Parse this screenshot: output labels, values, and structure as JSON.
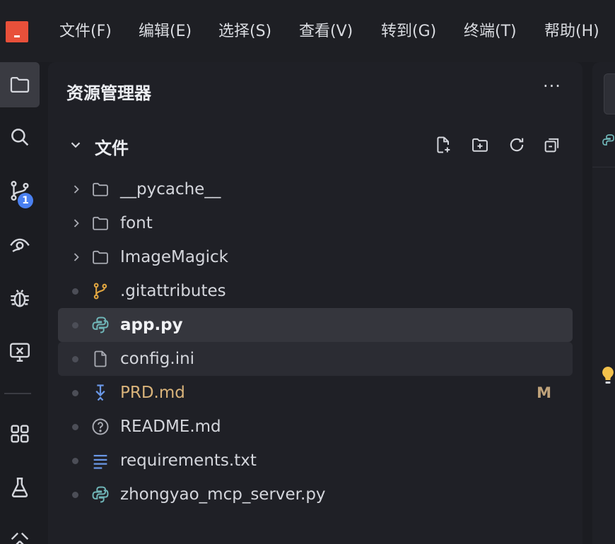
{
  "menu": {
    "items": [
      {
        "label": "文件(F)"
      },
      {
        "label": "编辑(E)"
      },
      {
        "label": "选择(S)"
      },
      {
        "label": "查看(V)"
      },
      {
        "label": "转到(G)"
      },
      {
        "label": "终端(T)"
      },
      {
        "label": "帮助(H)"
      }
    ]
  },
  "activity_bar": {
    "items": [
      {
        "icon": "files-icon",
        "active": true
      },
      {
        "icon": "search-icon"
      },
      {
        "icon": "source-control-icon",
        "badge": "1"
      },
      {
        "icon": "eye-icon"
      },
      {
        "icon": "debug-icon"
      },
      {
        "icon": "remote-icon"
      },
      {
        "icon": "extensions-icon"
      },
      {
        "icon": "testing-icon"
      },
      {
        "icon": "tools-icon"
      }
    ]
  },
  "explorer": {
    "title": "资源管理器",
    "more_label": "···",
    "section_title": "文件",
    "toolbar": [
      "new-file-icon",
      "new-folder-icon",
      "refresh-icon",
      "collapse-all-icon"
    ],
    "items": [
      {
        "label": "__pycache__",
        "type": "folder",
        "icon": "folder-icon"
      },
      {
        "label": "font",
        "type": "folder",
        "icon": "folder-icon"
      },
      {
        "label": "ImageMagick",
        "type": "folder",
        "icon": "folder-icon"
      },
      {
        "label": ".gitattributes",
        "type": "file",
        "icon": "git-branch-icon"
      },
      {
        "label": "app.py",
        "type": "file",
        "icon": "python-icon",
        "state": "selected"
      },
      {
        "label": "config.ini",
        "type": "file",
        "icon": "file-icon",
        "state": "hover"
      },
      {
        "label": "PRD.md",
        "type": "file",
        "icon": "download-arrow-icon",
        "status": "M"
      },
      {
        "label": "README.md",
        "type": "file",
        "icon": "question-icon"
      },
      {
        "label": "requirements.txt",
        "type": "file",
        "icon": "text-lines-icon"
      },
      {
        "label": "zhongyao_mcp_server.py",
        "type": "file",
        "icon": "python-icon"
      }
    ]
  },
  "colors": {
    "accent_badge": "#4a80f0",
    "modified": "#d9b37a",
    "modified_badge": "#bfa27a",
    "python": "#6fb5b7",
    "git": "#e0a540",
    "markdown_icon": "#6a97e6",
    "logo": "#e8503a",
    "bulb": "#f2c14b"
  }
}
